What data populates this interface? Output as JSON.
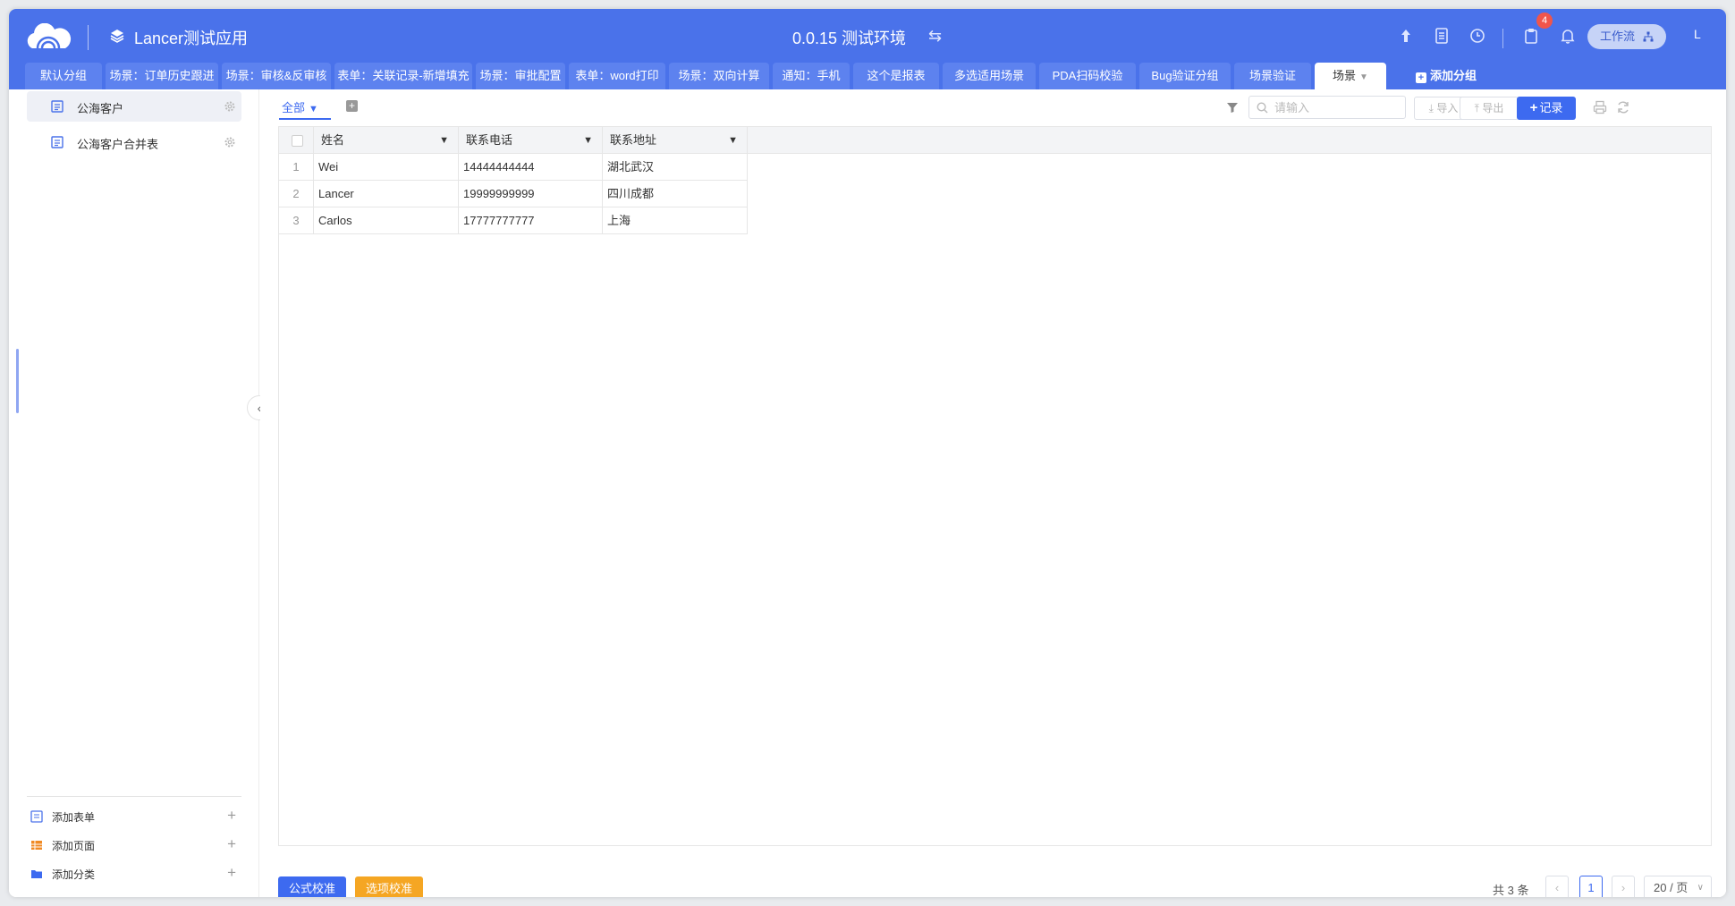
{
  "header": {
    "app_name": "Lancer测试应用",
    "env_title": "0.0.15 测试环境",
    "env_switch_icon": "⇆",
    "notification_count": "4",
    "workflow_label": "工作流",
    "user_initial": "L",
    "brand_color": "#4a72ea"
  },
  "tabs": [
    {
      "label": "默认分组"
    },
    {
      "label": "场景：订单历史跟进"
    },
    {
      "label": "场景：审核&反审核"
    },
    {
      "label": "表单：关联记录-新增填充"
    },
    {
      "label": "场景：审批配置"
    },
    {
      "label": "表单：word打印"
    },
    {
      "label": "场景：双向计算"
    },
    {
      "label": "通知：手机"
    },
    {
      "label": "这个是报表"
    },
    {
      "label": "多选适用场景"
    },
    {
      "label": "PDA扫码校验"
    },
    {
      "label": "Bug验证分组"
    },
    {
      "label": "场景验证"
    },
    {
      "label": "场景"
    },
    {
      "label": "添加分组"
    }
  ],
  "sidebar": {
    "items": [
      {
        "label": "公海客户"
      },
      {
        "label": "公海客户合并表"
      }
    ],
    "add_form": "添加表单",
    "add_page": "添加页面",
    "add_category": "添加分类"
  },
  "toolbar": {
    "view_label": "全部",
    "search_placeholder": "请输入",
    "import_label": "导入",
    "export_label": "导出",
    "add_record_label": "记录"
  },
  "table": {
    "columns": [
      "姓名",
      "联系电话",
      "联系地址"
    ],
    "rows": [
      {
        "num": "1",
        "name": "Wei",
        "phone": "14444444444",
        "address": "湖北武汉"
      },
      {
        "num": "2",
        "name": "Lancer",
        "phone": "19999999999",
        "address": "四川成都"
      },
      {
        "num": "3",
        "name": "Carlos",
        "phone": "17777777777",
        "address": "上海"
      }
    ]
  },
  "footer": {
    "formula_check": "公式校准",
    "option_check": "选项校准",
    "total": "共 3 条",
    "current_page": "1",
    "page_size": "20 / 页"
  }
}
